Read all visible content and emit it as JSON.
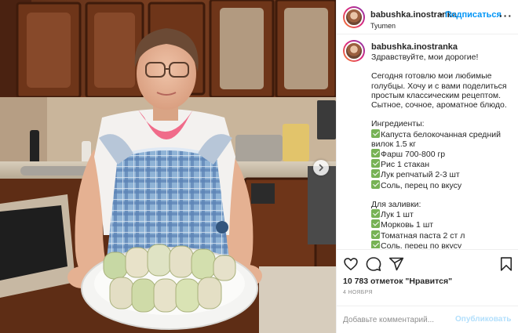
{
  "post": {
    "username": "babushka.inostranka",
    "separator": "•",
    "follow_label": "Подписаться",
    "location": "Tyumen",
    "more_label": "···"
  },
  "caption": {
    "username": "babushka.inostranka",
    "lines": [
      "Здравствуйте, мои дорогие!",
      "",
      "Сегодня готовлю мои любимые",
      "голубцы. Хочу и с вами поделиться",
      "простым классическим рецептом.",
      "Сытное, сочное, ароматное блюдо.",
      "",
      "Ингредиенты:",
      "Капуста белокочанная средний",
      "вилок 1.5 кг",
      "Фарш 700-800 гр",
      "Рис 1 стакан",
      "Лук репчатый 2-3 шт",
      "Соль, перец по вкусу",
      "",
      "Для заливки:",
      "Лук 1 шт",
      "Морковь 1 шт",
      "Томатная паста 2 ст л",
      "Соль, перец по вкусу"
    ],
    "checked_lines": [
      8,
      10,
      11,
      12,
      13,
      16,
      17,
      18,
      19
    ]
  },
  "stats": {
    "likes": "10 783 отметок \"Нравится\"",
    "date": "4 НОЯБРЯ"
  },
  "comment": {
    "placeholder": "Добавьте комментарий...",
    "post_label": "Опубликовать"
  },
  "icons": {
    "like": "heart-icon",
    "comment": "comment-icon",
    "share": "share-icon",
    "save": "bookmark-icon",
    "next": "chevron-right-icon",
    "checkmark": "check-mark-button-emoji"
  },
  "colors": {
    "accent": "#0095f6",
    "post_disabled": "#b2dffc",
    "check_green": "#77b255"
  }
}
